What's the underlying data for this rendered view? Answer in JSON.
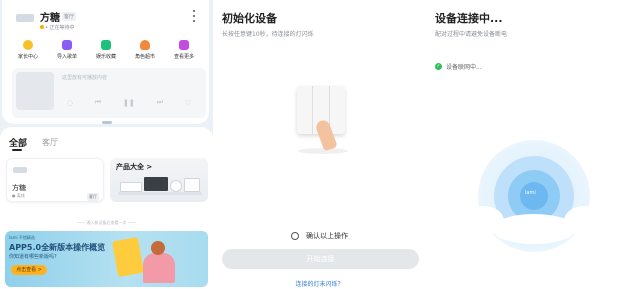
{
  "panel1": {
    "device": {
      "name": "方糖",
      "room": "客厅",
      "subtitle": "• 正在等待中"
    },
    "quick_actions": [
      {
        "label": "家长中心",
        "icon": "parent-center-icon",
        "color": "#f5c02b"
      },
      {
        "label": "导入歌单",
        "icon": "import-playlist-icon",
        "color": "#8a5cf2"
      },
      {
        "label": "娱乐收藏",
        "icon": "favorites-icon",
        "color": "#1fc07a"
      },
      {
        "label": "角色超市",
        "icon": "role-market-icon",
        "color": "#f08a3a"
      },
      {
        "label": "查看更多",
        "icon": "more-apps-icon",
        "color": "#c34ce0"
      }
    ],
    "player": {
      "placeholder": "这里放有可播放内容"
    },
    "tabs": {
      "all": "全部",
      "room": "客厅"
    },
    "device_card": {
      "name": "方糖",
      "subtitle": "● 离线",
      "room": "客厅"
    },
    "product_card": {
      "title": "产品大全 >"
    },
    "separator": "—— 通入新设备后查看一次 ——",
    "banner": {
      "brand": "lami 不错精选",
      "title": "APP5.0全新版本操作概览",
      "subtitle": "你知道有哪些新版吗?",
      "button": "点击查看 >"
    }
  },
  "panel2": {
    "title": "初始化设备",
    "subtitle": "长按任意键10秒，待连接的灯闪烁",
    "confirm_label": "确认以上操作",
    "start_button": "开始连接",
    "link": "连接的灯未闪烁？"
  },
  "panel3": {
    "title": "设备连接中...",
    "subtitle": "配对过程中请避免设备断电",
    "status": "设备联网中...",
    "ring_label": "lami"
  }
}
